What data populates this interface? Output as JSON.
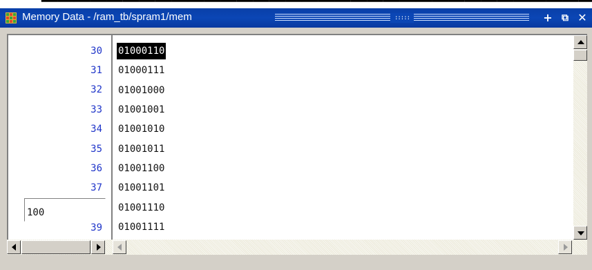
{
  "window": {
    "title": "Memory Data - /ram_tb/spram1/mem",
    "grip_dots": ":::::",
    "buttons": {
      "dock": "+",
      "undock": "⧉",
      "close": "✕"
    }
  },
  "addresses": [
    "30",
    "31",
    "32",
    "33",
    "34",
    "35",
    "36",
    "37",
    "39"
  ],
  "values": [
    "01000110",
    "01000111",
    "01001000",
    "01001001",
    "01001010",
    "01001011",
    "01001100",
    "01001101",
    "01001110",
    "01001111"
  ],
  "selected_index": 0,
  "address_edit": {
    "value": "100"
  },
  "colors": {
    "title_bar": "#0b46b5",
    "address_text": "#1f35c9",
    "selection_bg": "#000000",
    "chrome": "#d4d0c8"
  }
}
